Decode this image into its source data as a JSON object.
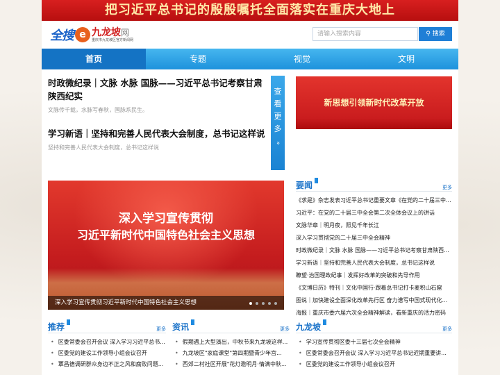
{
  "banner": {
    "text": "把习近平总书记的殷殷嘱托全面落实在重庆大地上"
  },
  "logo": {
    "quansou": "全搜",
    "e": "e",
    "name": "九龙坡",
    "wang": "网",
    "subtitle": "重庆市九龙坡区官方新闻网"
  },
  "search": {
    "placeholder": "请输入搜索内容",
    "button": "搜索"
  },
  "nav": [
    "首页",
    "专题",
    "视觉",
    "文明"
  ],
  "headlines": [
    {
      "title": "时政微纪录｜文脉 水脉 国脉——习近平总书记考察甘肃陕西纪实",
      "summary": "文脉传千载，水脉写春秋，国脉系民生。"
    },
    {
      "title": "学习新语｜坚持和完善人民代表大会制度，总书记这样说",
      "summary": "坚持和完善人民代表大会制度，总书记这样说"
    }
  ],
  "more_tab": {
    "chars": [
      "查",
      "看",
      "更",
      "多"
    ],
    "chevron": "»"
  },
  "promo": {
    "text": "新思想引领新时代改革开放"
  },
  "hero": {
    "line1": "深入学习宣传贯彻",
    "line2": "习近平新时代中国特色社会主义思想",
    "caption": "深入学习宣传贯彻习近平新时代中国特色社会主义思想"
  },
  "yaowen": {
    "title": "要闻",
    "more": "更多",
    "items": [
      "《求是》杂志发表习近平总书记重要文章《在党的二十届三中...",
      "习近平：在党的二十届三中全会第二次全体会议上的讲话",
      "文脉华章｜明月夜，照见千年长江",
      "深入学习贯彻党的二十届三中全会精神",
      "时政微纪录｜文脉 水脉 国脉——习近平总书记考察甘肃陕西...",
      "学习新语｜坚持和完善人民代表大会制度，总书记这样说",
      "瞭望·治国理政纪事｜发挥好改革的突破和先导作用",
      "《文博日历》特刊｜文化中国行·跟着总书记打卡麦积山石窟",
      "图说｜加快建设全面深化改革先行区  奋力谱写中国式现代化...",
      "海报｜重庆市委六届六次全会精神解读，看新重庆的活力密码"
    ]
  },
  "tuijian": {
    "title": "推荐",
    "more": "更多",
    "items": [
      "区委常委会召开会议 深入学习习近平总书...",
      "区委党的建设工作领导小组会议召开",
      "覃昌德调研群众身边不正之风和腐败问题..."
    ]
  },
  "zixun": {
    "title": "资讯",
    "more": "更多",
    "items": [
      "假期遇上大型演出，中秋节来九龙坡这样...",
      "九龙坡区\"家庭课堂\"第四期暨青少年宫...",
      "西郊二村社区开展\"花灯邀明月·情满中秋..."
    ]
  },
  "jiulongpo": {
    "title": "九龙坡",
    "more": "更多",
    "items": [
      "学习宣传贯彻区委十三届七次全会精神",
      "区委常委会召开会议 深入学习习近平总书记近期重要讲...",
      "区委党的建设工作领导小组会议召开"
    ]
  }
}
